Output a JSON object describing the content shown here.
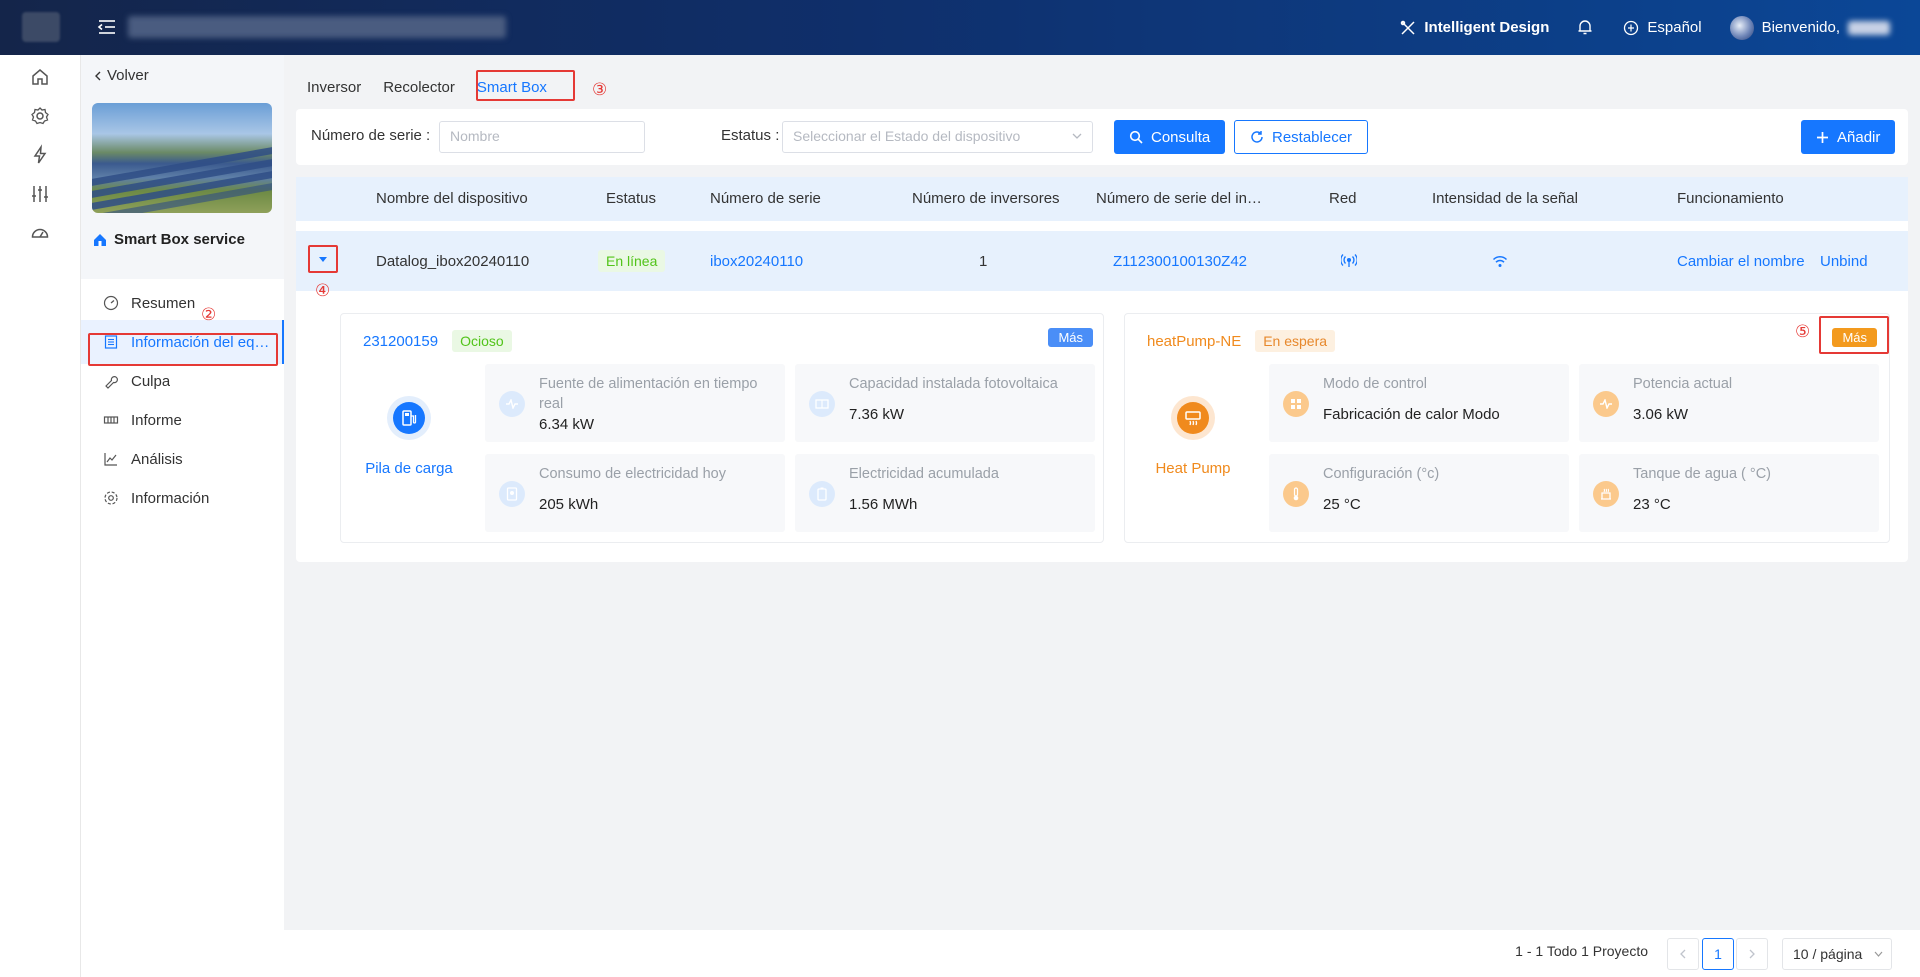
{
  "topbar": {
    "intelligent_design": "Intelligent Design",
    "language": "Español",
    "welcome": "Bienvenido,"
  },
  "sidebar": {
    "back": "Volver",
    "plant_name": "Smart Box service",
    "items": [
      {
        "label": "Resumen",
        "icon": "dashboard-icon"
      },
      {
        "label": "Información del equipo",
        "icon": "document-list-icon"
      },
      {
        "label": "Culpa",
        "icon": "wrench-icon"
      },
      {
        "label": "Informe",
        "icon": "report-icon"
      },
      {
        "label": "Análisis",
        "icon": "line-chart-icon"
      },
      {
        "label": "Información",
        "icon": "gear-icon"
      }
    ]
  },
  "tabs": [
    "Inversor",
    "Recolector",
    "Smart Box"
  ],
  "filter": {
    "serial_label": "Número de serie :",
    "serial_placeholder": "Nombre",
    "status_label": "Estatus :",
    "status_placeholder": "Seleccionar el Estado del dispositivo",
    "query_button": "Consulta",
    "reset_button": "Restablecer",
    "add_button": "Añadir"
  },
  "table": {
    "columns": [
      "Nombre del dispositivo",
      "Estatus",
      "Número de serie",
      "Número de inversores",
      "Número de serie del in…",
      "Red",
      "Intensidad de la señal",
      "Funcionamiento"
    ],
    "row": {
      "name": "Datalog_ibox20240110",
      "status": "En línea",
      "serial": "ibox20240110",
      "inverter_count": "1",
      "inverter_serial": "Z112300100130Z42",
      "rename": "Cambiar el nombre",
      "unbind": "Unbind"
    }
  },
  "cards": [
    {
      "id": "231200159",
      "state": "Ocioso",
      "more": "Más",
      "device": "Pila de carga",
      "metrics": [
        {
          "label": "Fuente de alimentación en tiempo real",
          "value": "6.34 kW"
        },
        {
          "label": "Capacidad instalada fotovoltaica",
          "value": "7.36 kW"
        },
        {
          "label": "Consumo de electricidad hoy",
          "value": "205 kWh"
        },
        {
          "label": "Electricidad acumulada",
          "value": "1.56 MWh"
        }
      ]
    },
    {
      "id": "heatPump-NE",
      "state": "En espera",
      "more": "Más",
      "device": "Heat Pump",
      "metrics": [
        {
          "label": "Modo de control",
          "value": "Fabricación de calor Modo"
        },
        {
          "label": "Potencia actual",
          "value": "3.06 kW"
        },
        {
          "label": "Configuración (°c)",
          "value": "25 °C"
        },
        {
          "label": "Tanque de agua ( °C)",
          "value": "23 °C"
        }
      ]
    }
  ],
  "annotations": [
    "②",
    "③",
    "④",
    "⑤"
  ],
  "pagination": {
    "summary": "1 - 1 Todo 1 Proyecto",
    "current": "1",
    "page_size": "10 / página"
  },
  "colors": {
    "accent": "#1677ff",
    "annotation": "#e53935",
    "heat": "#f08a1d",
    "online": "#52c41a"
  }
}
